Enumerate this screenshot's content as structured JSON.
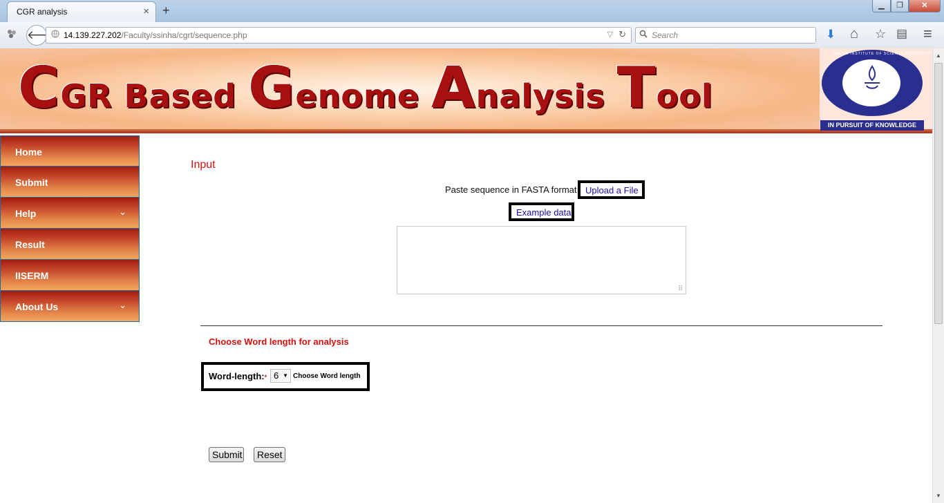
{
  "browser": {
    "tab_title": "CGR analysis",
    "tab_close": "×",
    "new_tab": "+",
    "window_controls": {
      "minimize": "▁",
      "maximize": "❐",
      "close": "✕"
    },
    "back_icon": "🡐",
    "url_host": "14.139.227.202",
    "url_path": "/Faculty/ssinha/cgrt/sequence.php",
    "url_dropdown": "▽",
    "url_reload": "↻",
    "search_placeholder": "Search",
    "toolbar_icons": {
      "download": "⬇",
      "home": "⌂",
      "bookmark": "☆",
      "reader": "▤",
      "menu": "≡"
    }
  },
  "banner": {
    "title_parts": [
      {
        "text": "C",
        "size": "big"
      },
      {
        "text": "GR ",
        "size": "small"
      },
      {
        "text": "B",
        "size": "small"
      },
      {
        "text": "ased ",
        "size": "small"
      },
      {
        "text": "G",
        "size": "big"
      },
      {
        "text": "enome ",
        "size": "small"
      },
      {
        "text": "A",
        "size": "big"
      },
      {
        "text": "nalysis ",
        "size": "small"
      },
      {
        "text": "T",
        "size": "big"
      },
      {
        "text": "ool",
        "size": "small"
      }
    ],
    "logo_ring_text": "INDIAN INSTITUTE OF SCIENCE EDUCATION AND RESEARCH MOHALI",
    "logo_motto": "IN PURSUIT OF KNOWLEDGE"
  },
  "sidebar": {
    "items": [
      {
        "label": "Home",
        "has_submenu": false
      },
      {
        "label": "Submit",
        "has_submenu": false
      },
      {
        "label": "Help",
        "has_submenu": true
      },
      {
        "label": "Result",
        "has_submenu": false
      },
      {
        "label": "IISERM",
        "has_submenu": false
      },
      {
        "label": "About Us",
        "has_submenu": true
      }
    ],
    "chevron": "⌄"
  },
  "main": {
    "input_heading": "Input",
    "paste_text": "Paste sequence in FASTA format",
    "upload_link": "Upload a File",
    "example_link": "Example data",
    "sequence_value": "",
    "resize_grip": "⠿",
    "choose_heading": "Choose Word length for analysis",
    "word_length_label": "Word-length:",
    "required_mark": "*",
    "word_length_value": "6",
    "word_length_hint": "Choose Word length",
    "submit_label": "Submit",
    "reset_label": "Reset"
  },
  "colors": {
    "accent_red": "#d21010",
    "link_blue": "#1a0dab",
    "logo_blue": "#2a2f8f"
  }
}
